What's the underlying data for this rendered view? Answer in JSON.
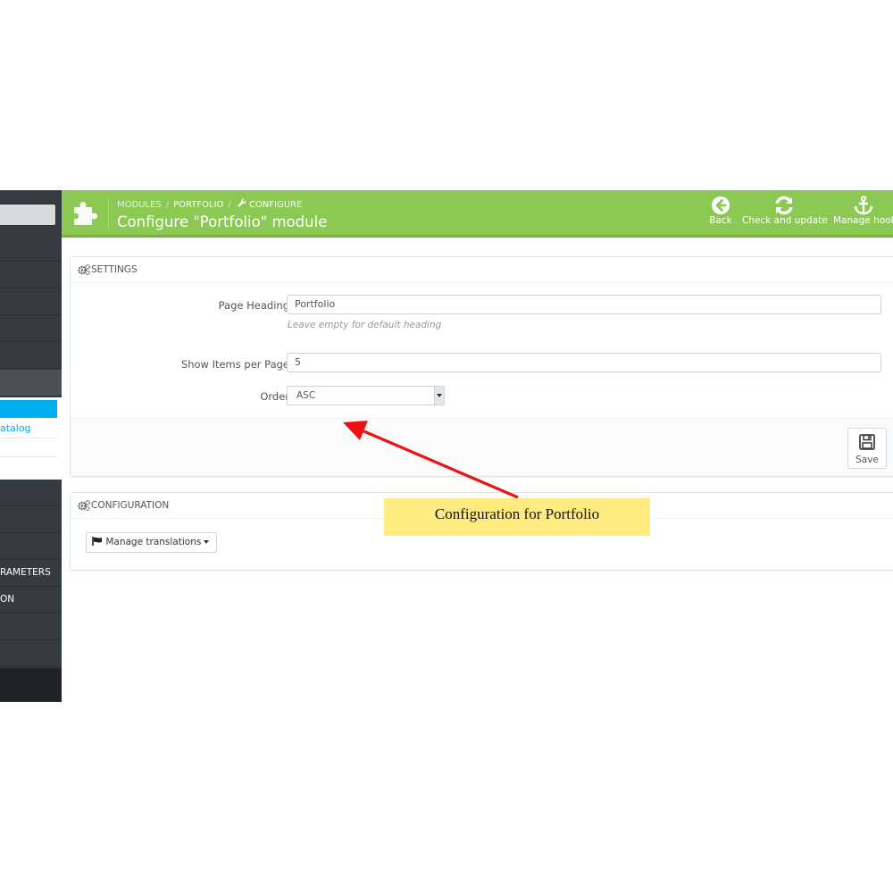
{
  "sidebar": {
    "labels": {
      "submenu_item": "atalog",
      "parameters": "RAMETERS",
      "section": "ON"
    }
  },
  "header": {
    "breadcrumb": [
      "MODULES",
      "PORTFOLIO",
      "CONFIGURE"
    ],
    "title": "Configure \"Portfolio\" module",
    "toolbar": {
      "back": "Back",
      "check_update": "Check and update",
      "manage_hooks": "Manage hook"
    }
  },
  "settings": {
    "title": "SETTINGS",
    "page_heading": {
      "label": "Page Heading",
      "value": "Portfolio",
      "help": "Leave empty for default heading"
    },
    "items_per_page": {
      "label": "Show Items per Page",
      "value": "5"
    },
    "order": {
      "label": "Order",
      "value": "ASC"
    },
    "save_label": "Save"
  },
  "configuration": {
    "title": "CONFIGURATION",
    "manage_translations": "Manage translations"
  },
  "annotation": {
    "text": "Configuration for Portfolio"
  },
  "colors": {
    "header_green": "#8bc954",
    "sidebar_dark": "#363a41",
    "accent_blue": "#00aff0",
    "callout_yellow": "#ffeb80",
    "arrow_red": "#ee1111"
  }
}
